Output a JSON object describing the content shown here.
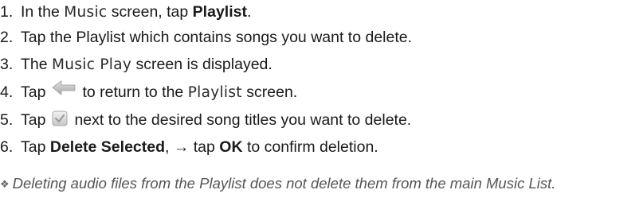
{
  "steps": [
    {
      "num": "1.",
      "a": "In the ",
      "b": "Music",
      "c": " screen, tap ",
      "d": "Playlist",
      "e": "."
    },
    {
      "num": "2.",
      "text": "Tap the Playlist which contains songs you want to delete."
    },
    {
      "num": "3.",
      "a": "The ",
      "b": "Music Play",
      "c": " screen is displayed."
    },
    {
      "num": "4.",
      "a": "Tap",
      "icon": "back-arrow-icon",
      "b": "to return to the ",
      "c": "Playlist",
      "d": " screen."
    },
    {
      "num": "5.",
      "a": "Tap",
      "icon": "checkbox-icon",
      "b": "next to the desired song titles you want to delete."
    },
    {
      "num": "6.",
      "a": "Tap ",
      "b": "Delete Selected",
      "c": ", → tap ",
      "d": "OK",
      "e": " to confirm deletion."
    }
  ],
  "note": {
    "bullet": "❖",
    "text": "Deleting audio files from the Playlist does not delete them from the main Music List."
  },
  "colors": {
    "text": "#1a1a1a",
    "note": "#555555",
    "icon": "#bdbdbd"
  }
}
